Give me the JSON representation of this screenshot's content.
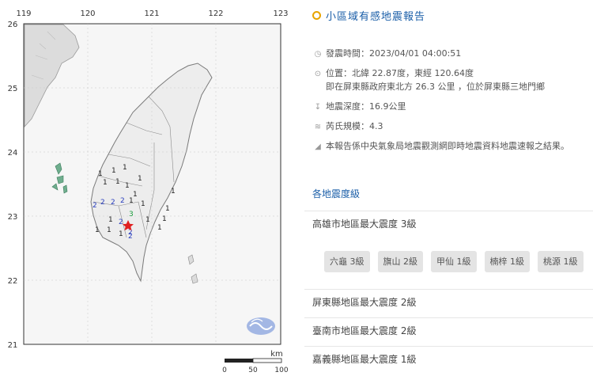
{
  "map": {
    "lon_labels": [
      "119",
      "120",
      "121",
      "122",
      "123"
    ],
    "lat_labels": [
      "26",
      "25",
      "24",
      "23",
      "22",
      "21"
    ],
    "scale_unit": "km",
    "scale_ticks": [
      "0",
      "50",
      "100"
    ],
    "epicenter_marker": "star-icon",
    "intensity_labels": [
      {
        "v": "1",
        "c": "#222"
      },
      {
        "v": "1",
        "c": "#222"
      },
      {
        "v": "1",
        "c": "#222"
      },
      {
        "v": "1",
        "c": "#222"
      },
      {
        "v": "1",
        "c": "#222"
      },
      {
        "v": "1",
        "c": "#222"
      },
      {
        "v": "1",
        "c": "#222"
      },
      {
        "v": "1",
        "c": "#222"
      },
      {
        "v": "1",
        "c": "#222"
      },
      {
        "v": "2",
        "c": "#2a3fbf"
      },
      {
        "v": "2",
        "c": "#2a3fbf"
      },
      {
        "v": "2",
        "c": "#2a3fbf"
      },
      {
        "v": "2",
        "c": "#2a3fbf"
      },
      {
        "v": "1",
        "c": "#222"
      },
      {
        "v": "1",
        "c": "#222"
      },
      {
        "v": "3",
        "c": "#1e9e3e"
      },
      {
        "v": "2",
        "c": "#2a3fbf"
      },
      {
        "v": "2",
        "c": "#2a3fbf"
      },
      {
        "v": "2",
        "c": "#2a3fbf"
      },
      {
        "v": "1",
        "c": "#222"
      },
      {
        "v": "1",
        "c": "#222"
      },
      {
        "v": "1",
        "c": "#222"
      },
      {
        "v": "1",
        "c": "#222"
      },
      {
        "v": "1",
        "c": "#222"
      },
      {
        "v": "1",
        "c": "#222"
      },
      {
        "v": "1",
        "c": "#222"
      },
      {
        "v": "1",
        "c": "#222"
      }
    ]
  },
  "report": {
    "title": "小區域有感地震報告",
    "time_label": "發震時間：2023/04/01 04:00:51",
    "location_line1": "位置：北緯 22.87度，東經 120.64度",
    "location_line2": "即在屏東縣政府東北方 26.3 公里 ，位於屏東縣三地門鄉",
    "depth_label": "地震深度：16.9公里",
    "magnitude_label": "芮氏規模：4.3",
    "note": "本報告係中央氣象局地震觀測網即時地震資料地震速報之結果。",
    "section_link": "各地震度級"
  },
  "regions": [
    {
      "title": "高雄市地區最大震度 3級"
    },
    {
      "title": "屏東縣地區最大震度 2級"
    },
    {
      "title": "臺南市地區最大震度 2級"
    },
    {
      "title": "嘉義縣地區最大震度 1級"
    }
  ],
  "kaohsiung_stations": [
    "六龜 3級",
    "旗山 2級",
    "甲仙 1級",
    "楠梓 1級",
    "桃源 1級"
  ],
  "colors": {
    "accent": "#1a5ea8",
    "title_ring": "#e8a400",
    "intensity_1": "#222222",
    "intensity_2": "#2a3fbf",
    "intensity_3": "#1e9e3e",
    "epicenter": "#e02020"
  }
}
